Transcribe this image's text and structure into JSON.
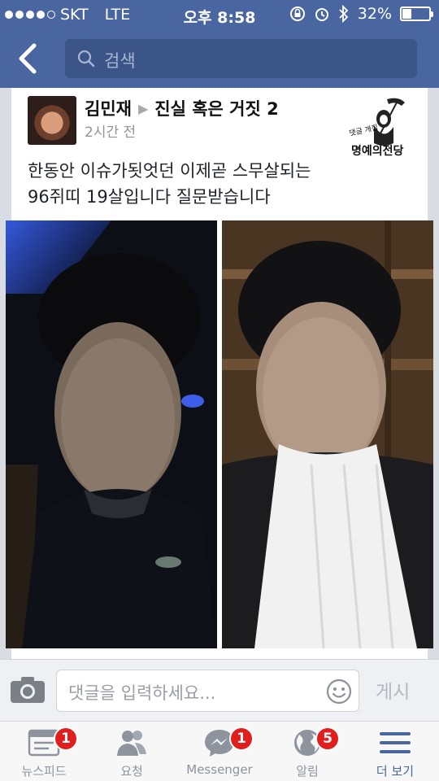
{
  "status_bar": {
    "carrier": "SKT",
    "network": "LTE",
    "time": "오후 8:58",
    "battery_percent": "32%",
    "battery_level": 0.32
  },
  "nav": {
    "search_placeholder": "검색"
  },
  "post": {
    "author": "김민재",
    "group": "진실 혹은 거짓 2",
    "time": "2시간 전",
    "text_line1": "한동안 이슈가됫엇던 이제곧 스무살되는",
    "text_line2": "96쥐띠 19살입니다 질문받습니다",
    "logo_text": "명예의전당"
  },
  "comment": {
    "placeholder": "댓글을 입력하세요...",
    "post_label": "게시"
  },
  "tabs": [
    {
      "label": "뉴스피드",
      "badge": "1",
      "icon": "newsfeed-icon"
    },
    {
      "label": "요청",
      "badge": "",
      "icon": "friend-requests-icon"
    },
    {
      "label": "Messenger",
      "badge": "1",
      "icon": "messenger-icon"
    },
    {
      "label": "알림",
      "badge": "5",
      "icon": "notifications-globe-icon"
    },
    {
      "label": "더 보기",
      "badge": "",
      "icon": "menu-icon"
    }
  ],
  "colors": {
    "facebook_blue": "#4a66a0",
    "badge_red": "#e11d1d"
  }
}
